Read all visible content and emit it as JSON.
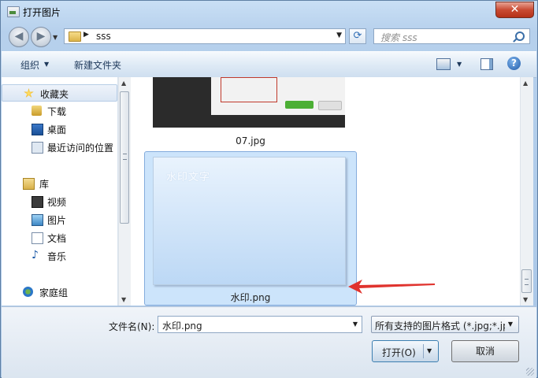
{
  "window": {
    "title": "打开图片"
  },
  "nav": {
    "back_glyph": "◀",
    "forward_glyph": "▶",
    "address_path": "sss",
    "search_placeholder": "搜索 sss"
  },
  "toolbar": {
    "organize_label": "组织",
    "new_folder_label": "新建文件夹",
    "help_glyph": "?"
  },
  "sidebar": {
    "favorites": "收藏夹",
    "downloads": "下载",
    "desktop": "桌面",
    "recent": "最近访问的位置",
    "libraries": "库",
    "videos": "视频",
    "pictures": "图片",
    "documents": "文档",
    "music": "音乐",
    "homegroup": "家庭组"
  },
  "files": {
    "item1_name": "07.jpg",
    "item2_name": "水印.png",
    "item2_thumbnail_text": "水印文字"
  },
  "bottom": {
    "filename_label": "文件名(N):",
    "filename_value": "水印.png",
    "filter_value": "所有支持的图片格式 (*.jpg;*.jp",
    "open_label": "打开(O)",
    "cancel_label": "取消"
  },
  "colors": {
    "selection_bg": "#cce4fb",
    "selection_border": "#84acdd",
    "annotation_arrow": "#e0332e"
  }
}
